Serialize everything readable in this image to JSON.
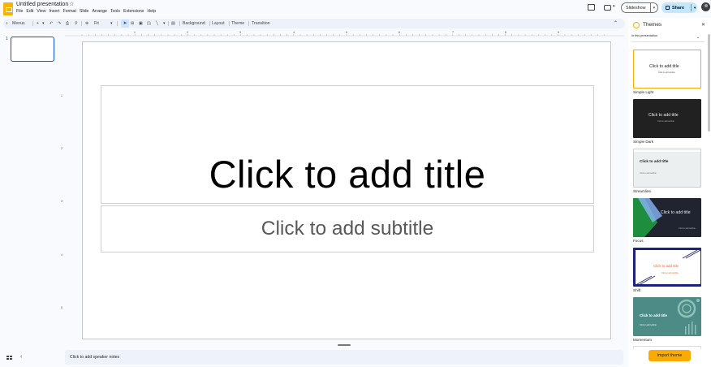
{
  "header": {
    "title": "Untitled presentation",
    "menu": [
      "File",
      "Edit",
      "View",
      "Insert",
      "Format",
      "Slide",
      "Arrange",
      "Tools",
      "Extensions",
      "Help"
    ],
    "slideshow_label": "Slideshow",
    "share_label": "Share"
  },
  "toolbar": {
    "menus_label": "Menus",
    "zoom_label": "Fit",
    "background_label": "Background",
    "layout_label": "Layout",
    "theme_label": "Theme",
    "transition_label": "Transition"
  },
  "filmstrip": {
    "slide_number": "1"
  },
  "rulers": {
    "top": [
      "1",
      "2",
      "3",
      "4",
      "5",
      "6",
      "7",
      "8",
      "9"
    ],
    "left": [
      "1",
      "2",
      "3",
      "4",
      "5"
    ]
  },
  "slide": {
    "title_placeholder": "Click to add title",
    "subtitle_placeholder": "Click to add subtitle"
  },
  "notes": {
    "placeholder": "Click to add speaker notes"
  },
  "themes": {
    "heading": "Themes",
    "filter": "In this presentation",
    "card_title": "Click to add title",
    "card_subtitle": "Click to add subtitle",
    "items": [
      "Simple Light",
      "Simple Dark",
      "Streamline",
      "Focus",
      "Shift",
      "Momentum"
    ],
    "import_label": "Import theme"
  },
  "colors": {
    "accent": "#0b57d0",
    "share_bg": "#c2e7ff",
    "import_button": "#f9ab00",
    "logo": "#f4b400"
  }
}
